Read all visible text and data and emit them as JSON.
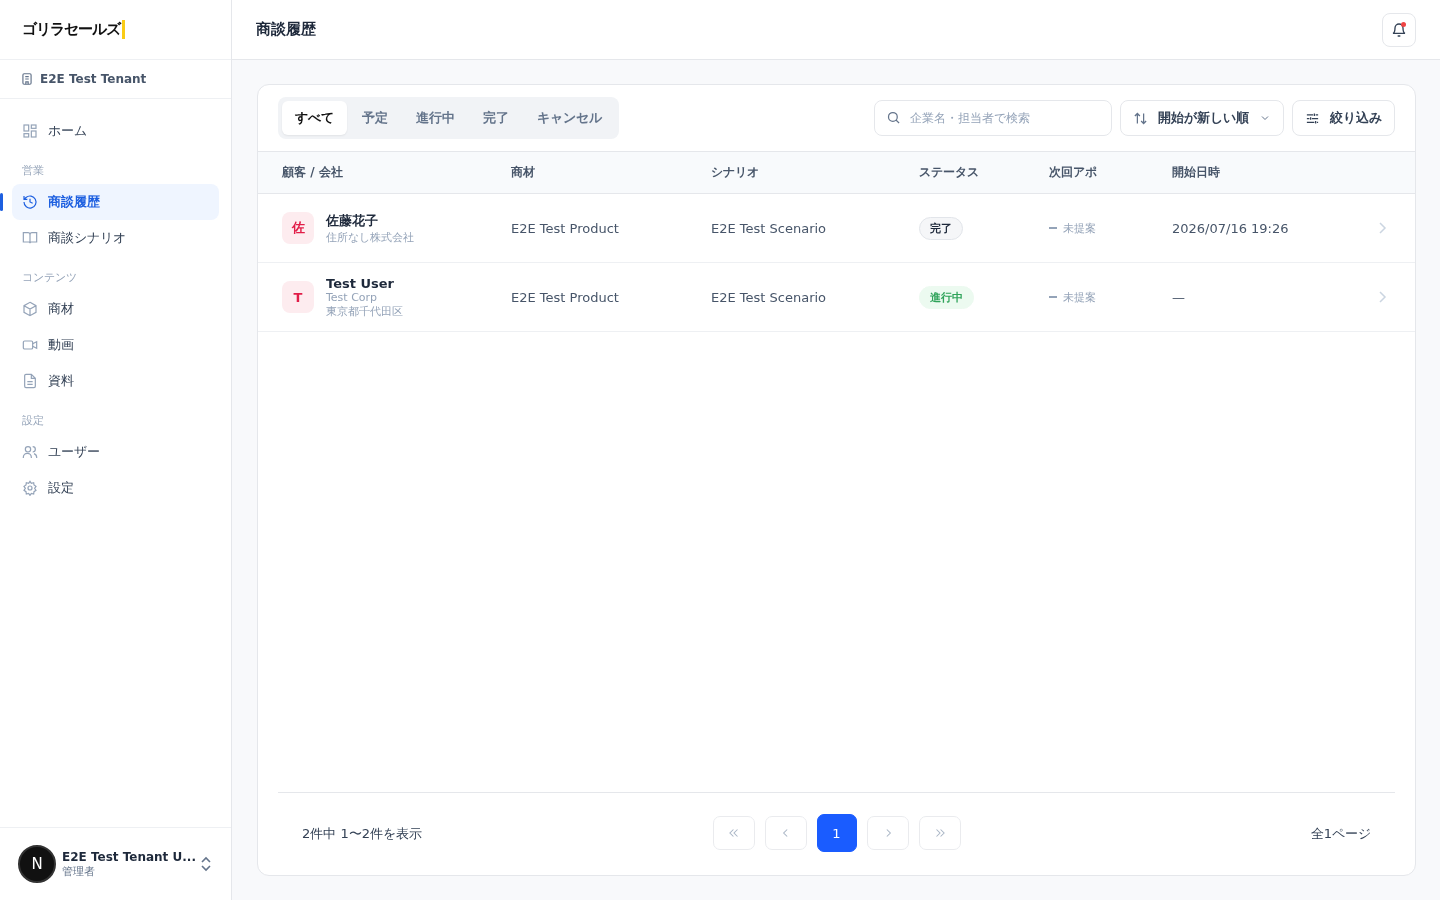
{
  "logo": {
    "text": "ゴリラセールズ"
  },
  "tenant": {
    "name": "E2E Test Tenant"
  },
  "nav": [
    {
      "kind": "grid",
      "label": "ホーム",
      "selected": false
    },
    {
      "kind": "section",
      "label": "営業"
    },
    {
      "kind": "history",
      "label": "商談履歴",
      "selected": true
    },
    {
      "kind": "book",
      "label": "商談シナリオ",
      "selected": false
    },
    {
      "kind": "section",
      "label": "コンテンツ"
    },
    {
      "kind": "box",
      "label": "商材",
      "selected": false
    },
    {
      "kind": "video",
      "label": "動画",
      "selected": false
    },
    {
      "kind": "doc",
      "label": "資料",
      "selected": false
    },
    {
      "kind": "section",
      "label": "設定"
    },
    {
      "kind": "users",
      "label": "ユーザー",
      "selected": false
    },
    {
      "kind": "gear",
      "label": "設定",
      "selected": false
    }
  ],
  "account": {
    "initial": "N",
    "name": "E2E Test Tenant U...",
    "role": "管理者"
  },
  "header": {
    "title": "商談履歴",
    "notification": true
  },
  "tabs": [
    {
      "label": "すべて",
      "selected": true
    },
    {
      "label": "予定",
      "selected": false
    },
    {
      "label": "進行中",
      "selected": false
    },
    {
      "label": "完了",
      "selected": false
    },
    {
      "label": "キャンセル",
      "selected": false
    }
  ],
  "search": {
    "placeholder": "企業名・担当者で検索"
  },
  "sort": {
    "label": "開始が新しい順"
  },
  "filter": {
    "label": "絞り込み"
  },
  "table": {
    "columns": [
      "顧客 / 会社",
      "商材",
      "シナリオ",
      "ステータス",
      "次回アポ",
      "開始日時"
    ],
    "rows": [
      {
        "initial": "佐",
        "name": "佐藤花子",
        "lines": [
          "住所なし株式会社"
        ],
        "product": "E2E Test Product",
        "scenario": "E2E Test Scenario",
        "status": {
          "label": "完了",
          "kind": "done"
        },
        "next": "未提案",
        "start": "2026/07/16 19:26"
      },
      {
        "initial": "T",
        "name": "Test User",
        "lines": [
          "Test Corp",
          "東京都千代田区"
        ],
        "product": "E2E Test Product",
        "scenario": "E2E Test Scenario",
        "status": {
          "label": "進行中",
          "kind": "active"
        },
        "next": "未提案",
        "start": "—"
      }
    ]
  },
  "pagination": {
    "summary": "2件中 1〜2件を表示",
    "total": "全1ページ",
    "buttons": [
      {
        "kind": "first",
        "disabled": true
      },
      {
        "kind": "prev",
        "disabled": true
      },
      {
        "kind": "page",
        "label": "1",
        "selected": true
      },
      {
        "kind": "next",
        "disabled": true
      },
      {
        "kind": "last",
        "disabled": true
      }
    ]
  }
}
